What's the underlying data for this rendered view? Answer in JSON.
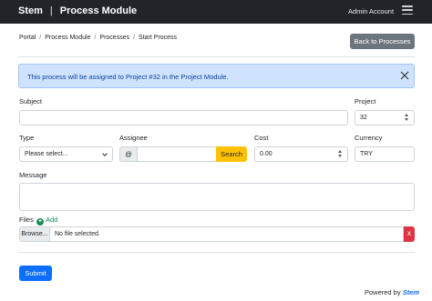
{
  "navbar": {
    "brand": "Stem",
    "separator": "|",
    "module": "Process Module",
    "account": "Admin Account",
    "menu_icon": "hamburger-icon"
  },
  "breadcrumb": {
    "items": [
      "Portal",
      "Process Module",
      "Processes",
      "Start Process"
    ],
    "divider": "/"
  },
  "back_button": "Back to Processes",
  "alert": {
    "message": "This process will be assigned to Project #32 in the Project Module.",
    "close_icon": "close-icon"
  },
  "form": {
    "subject": {
      "label": "Subject",
      "value": ""
    },
    "project": {
      "label": "Project",
      "value": "32"
    },
    "type": {
      "label": "Type",
      "value": "Please select..."
    },
    "assignee": {
      "label": "Assignee",
      "prefix": "@",
      "value": "",
      "button": "Search"
    },
    "cost": {
      "label": "Cost",
      "value": "0.00"
    },
    "currency": {
      "label": "Currency",
      "value": "TRY"
    },
    "message": {
      "label": "Message",
      "value": ""
    },
    "files": {
      "label": "Files",
      "add_label": "Add",
      "browse_label": "Browse...",
      "file_status": "No file selected.",
      "remove_label": "x"
    },
    "submit": "Submit"
  },
  "footer": {
    "powered_by": "Powered by",
    "brand": "Stem"
  },
  "colors": {
    "navbar": "#212529",
    "alert_bg": "#cfe2ff",
    "primary": "#0d6efd",
    "secondary": "#6c757d",
    "warning": "#ffc107",
    "success": "#198754",
    "danger": "#dc3545"
  }
}
